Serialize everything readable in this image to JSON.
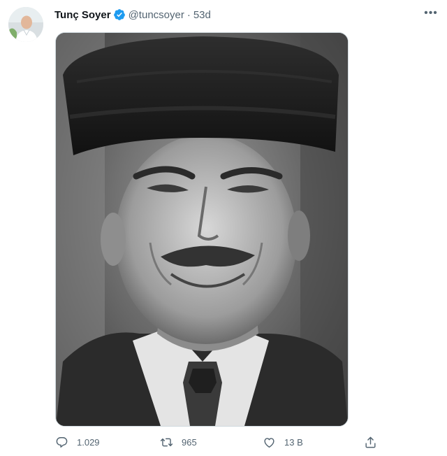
{
  "tweet": {
    "display_name": "Tunç Soyer",
    "handle": "@tuncsoyer",
    "separator": "·",
    "time": "53d",
    "verified_icon": "verified-badge-icon",
    "more_icon": "more-horizontal-icon",
    "more_label": "•••",
    "media": {
      "icon": "photo",
      "description_visible": false
    },
    "actions": {
      "replies": "1.029",
      "retweets": "965",
      "likes": "13 B",
      "reply_icon": "reply-icon",
      "retweet_icon": "retweet-icon",
      "like_icon": "heart-icon",
      "share_icon": "share-icon"
    }
  },
  "colors": {
    "text": "#0f1419",
    "secondary": "#536471",
    "verified": "#1d9bf0",
    "border": "#cfd9de"
  }
}
